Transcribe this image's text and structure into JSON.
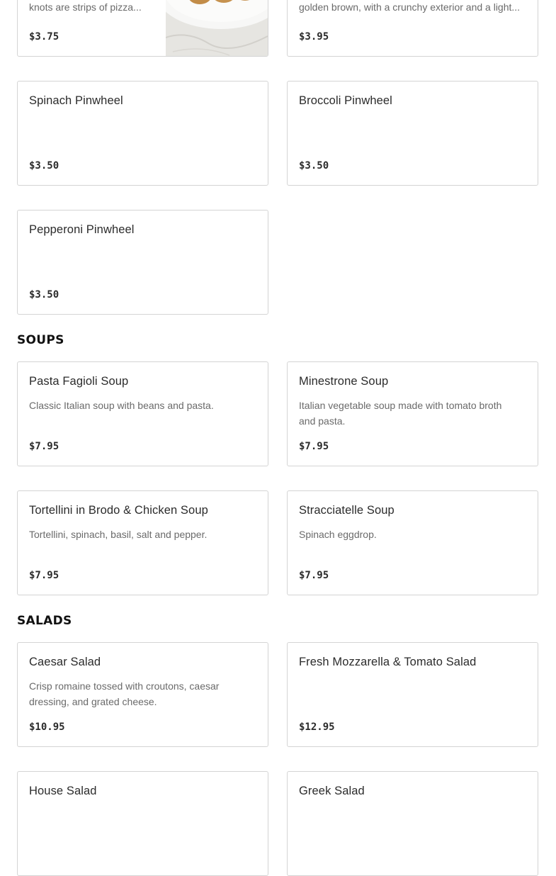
{
  "top_row": {
    "left": {
      "desc_fragment": "knots are strips of pizza...",
      "price": "$3.75"
    },
    "right": {
      "desc_fragment": "golden brown, with a crunchy exterior and a light...",
      "price": "$3.95"
    }
  },
  "pinwheels": [
    {
      "name": "Spinach Pinwheel",
      "price": "$3.50"
    },
    {
      "name": "Broccoli Pinwheel",
      "price": "$3.50"
    },
    {
      "name": "Pepperoni Pinwheel",
      "price": "$3.50"
    }
  ],
  "soups": {
    "title": "SOUPS",
    "items": [
      {
        "name": "Pasta Fagioli Soup",
        "description": "Classic Italian soup with beans and pasta.",
        "price": "$7.95"
      },
      {
        "name": "Minestrone Soup",
        "description": "Italian vegetable soup made with tomato broth and pasta.",
        "price": "$7.95"
      },
      {
        "name": "Tortellini in Brodo & Chicken Soup",
        "description": "Tortellini, spinach, basil, salt and pepper.",
        "price": "$7.95"
      },
      {
        "name": "Stracciatelle Soup",
        "description": "Spinach eggdrop.",
        "price": "$7.95"
      }
    ]
  },
  "salads": {
    "title": "SALADS",
    "items": [
      {
        "name": "Caesar Salad",
        "description": "Crisp romaine tossed with croutons, caesar dressing, and grated cheese.",
        "price": "$10.95"
      },
      {
        "name": "Fresh Mozzarella & Tomato Salad",
        "price": "$12.95"
      },
      {
        "name": "House Salad"
      },
      {
        "name": "Greek Salad"
      }
    ]
  }
}
